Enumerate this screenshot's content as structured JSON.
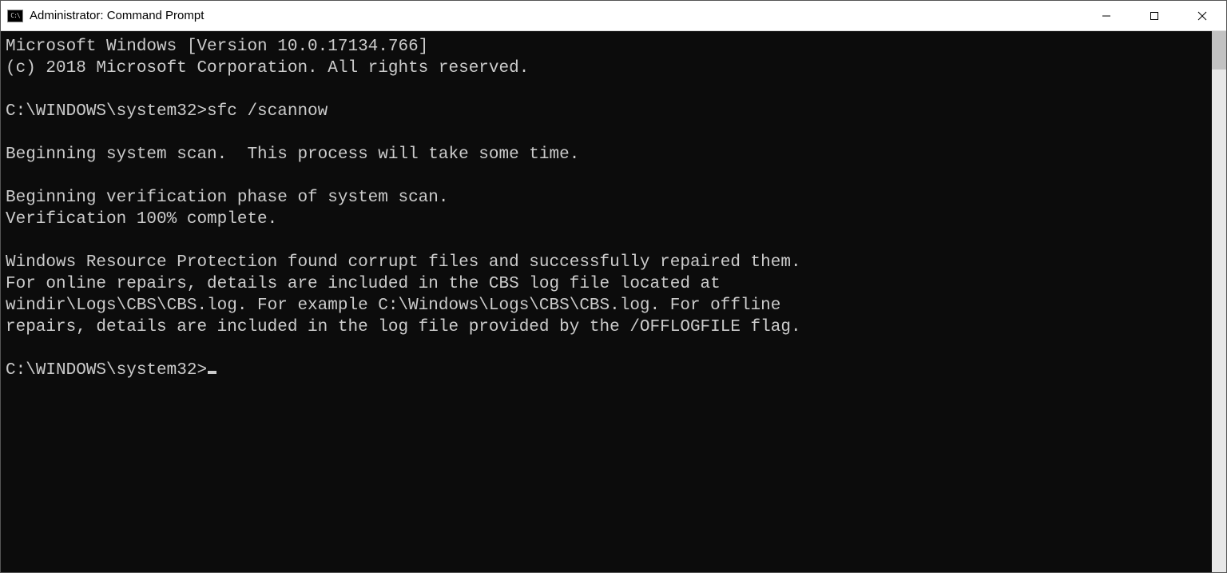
{
  "window": {
    "title": "Administrator: Command Prompt"
  },
  "console": {
    "lines": [
      "Microsoft Windows [Version 10.0.17134.766]",
      "(c) 2018 Microsoft Corporation. All rights reserved.",
      "",
      "C:\\WINDOWS\\system32>sfc /scannow",
      "",
      "Beginning system scan.  This process will take some time.",
      "",
      "Beginning verification phase of system scan.",
      "Verification 100% complete.",
      "",
      "Windows Resource Protection found corrupt files and successfully repaired them.",
      "For online repairs, details are included in the CBS log file located at",
      "windir\\Logs\\CBS\\CBS.log. For example C:\\Windows\\Logs\\CBS\\CBS.log. For offline",
      "repairs, details are included in the log file provided by the /OFFLOGFILE flag.",
      ""
    ],
    "current_prompt": "C:\\WINDOWS\\system32>"
  }
}
